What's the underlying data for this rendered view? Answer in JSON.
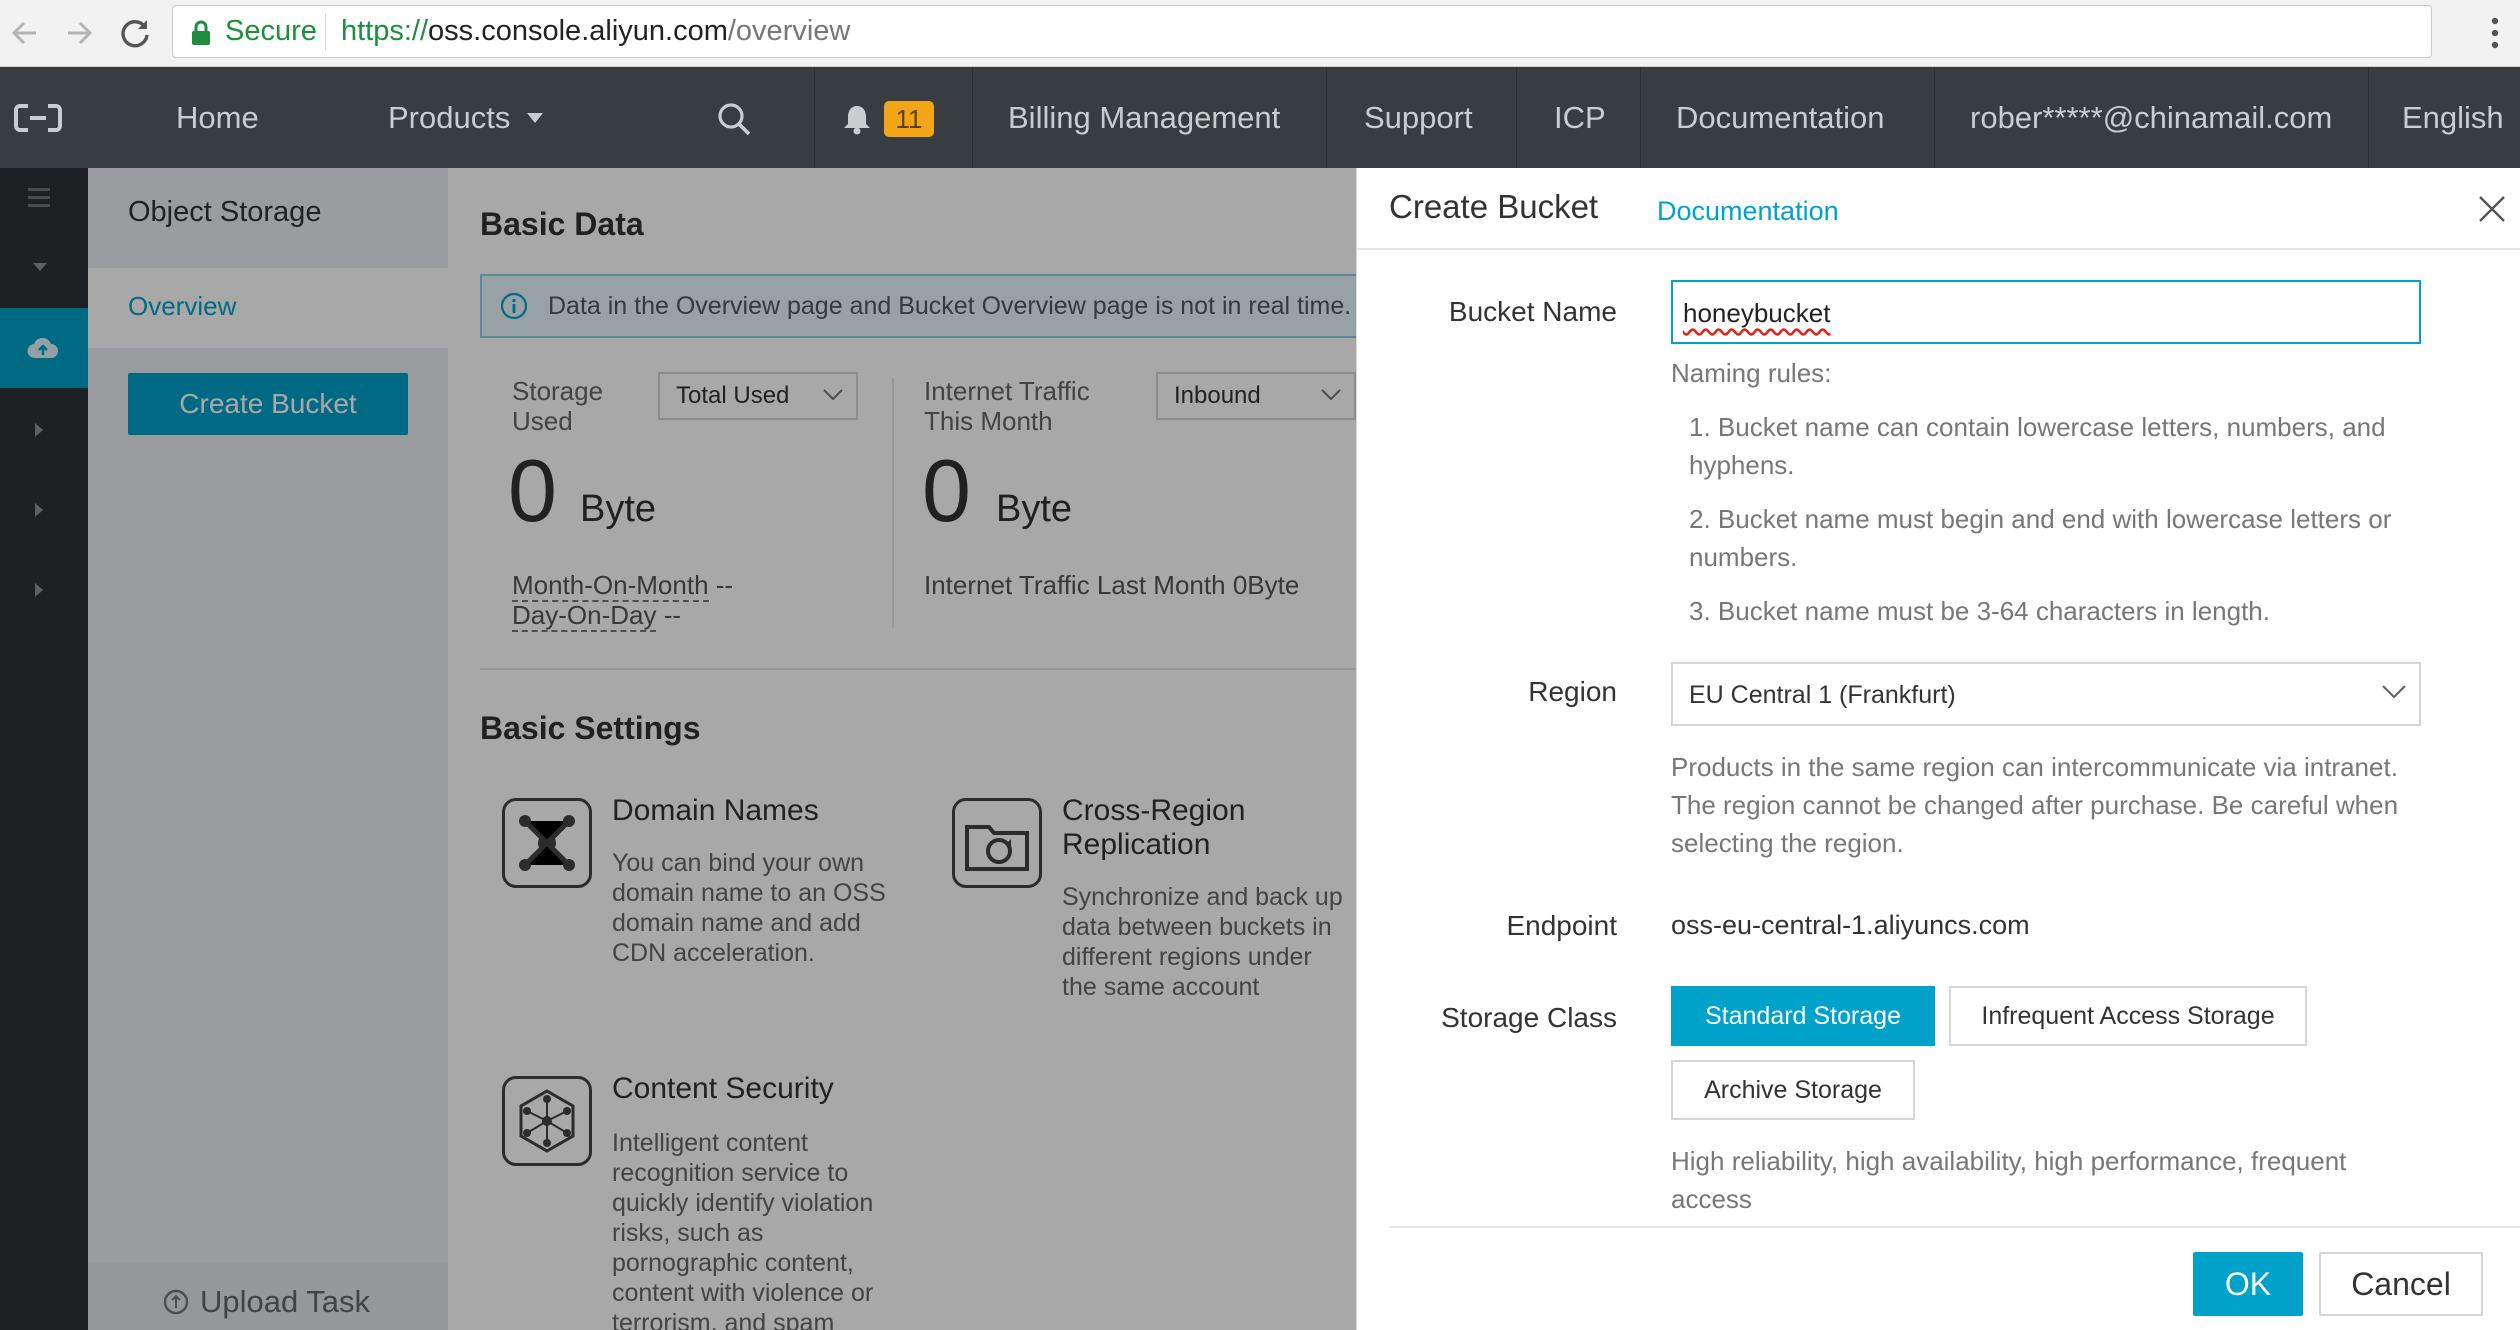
{
  "browser": {
    "secure_label": "Secure",
    "url_scheme": "https://",
    "url_host": "oss.console.aliyun.com",
    "url_path": "/overview"
  },
  "topnav": {
    "home": "Home",
    "products": "Products",
    "notification_count": "11",
    "billing": "Billing Management",
    "support": "Support",
    "icp": "ICP",
    "documentation": "Documentation",
    "account": "rober*****@chinamail.com",
    "language": "English"
  },
  "sidebar": {
    "title": "Object Storage",
    "overview": "Overview",
    "create_bucket": "Create Bucket",
    "upload_task": "Upload Task"
  },
  "main": {
    "basic_data_title": "Basic Data",
    "info_banner": "Data in the Overview page and Bucket Overview page is not in real time. It is",
    "storage_used_label": "Storage Used",
    "storage_select": "Total Used",
    "storage_value": "0",
    "storage_unit": "Byte",
    "month_on_month": "Month-On-Month",
    "month_on_month_value": "--",
    "day_on_day": "Day-On-Day",
    "day_on_day_value": "--",
    "traffic_label": "Internet Traffic This Month",
    "traffic_select": "Inbound",
    "traffic_value": "0",
    "traffic_unit": "Byte",
    "traffic_last_month": "Internet Traffic Last Month",
    "traffic_last_month_value": "0Byte",
    "basic_settings_title": "Basic Settings",
    "cards": [
      {
        "title": "Domain Names",
        "desc": "You can bind your own domain name to an OSS domain name and add CDN acceleration.",
        "icon": "domain-network-icon"
      },
      {
        "title": "Cross-Region Replication",
        "desc": "Synchronize and back up data between buckets in different regions under the same account",
        "icon": "folder-sync-icon"
      },
      {
        "title": "Content Security",
        "desc": "Intelligent content recognition service to quickly identify violation risks, such as pornographic content, content with violence or terrorism, and spam",
        "icon": "hexagon-network-icon"
      }
    ]
  },
  "drawer": {
    "title": "Create Bucket",
    "doc_link": "Documentation",
    "bucket_name_label": "Bucket Name",
    "bucket_name_value": "honeybucket",
    "naming_rules_title": "Naming rules:",
    "rules": [
      "1. Bucket name can contain lowercase letters, numbers, and hyphens.",
      "2. Bucket name must begin and end with lowercase letters or numbers.",
      "3. Bucket name must be 3-64 characters in length."
    ],
    "region_label": "Region",
    "region_value": "EU Central 1 (Frankfurt)",
    "region_help": "Products in the same region can intercommunicate via intranet. The region cannot be changed after purchase. Be careful when selecting the region.",
    "endpoint_label": "Endpoint",
    "endpoint_value": "oss-eu-central-1.aliyuncs.com",
    "storage_class_label": "Storage Class",
    "storage_classes": [
      "Standard Storage",
      "Infrequent Access Storage",
      "Archive Storage"
    ],
    "storage_class_selected": "Standard Storage",
    "storage_class_help": "High reliability, high availability, high performance, frequent access",
    "ok": "OK",
    "cancel": "Cancel"
  },
  "colors": {
    "accent": "#00a2ca",
    "topnav_bg": "#373d41",
    "badge": "#f2a516",
    "secure_green": "#1e8e3e"
  }
}
